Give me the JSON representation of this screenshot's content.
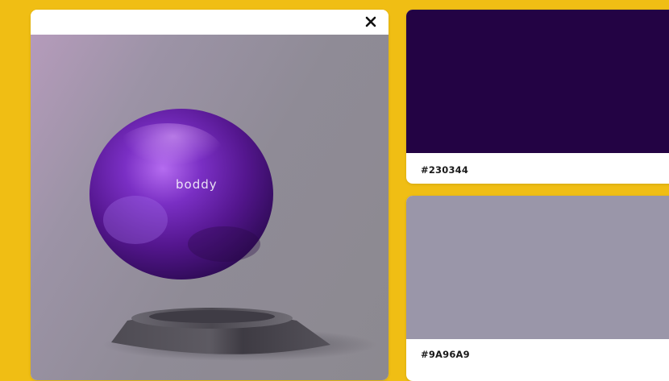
{
  "modal": {
    "close_icon": "close-icon",
    "image": {
      "brand_text": "boddy",
      "description_colors": {
        "sphere": "#5A1C8E",
        "stand": "#5E5B63"
      }
    }
  },
  "swatches": [
    {
      "color": "#230344",
      "label": "#230344"
    },
    {
      "color": "#9A96A9",
      "label": "#9A96A9"
    }
  ],
  "colors": {
    "background": "#F0BE14",
    "card": "#FFFFFF",
    "text": "#1A1A1A"
  }
}
